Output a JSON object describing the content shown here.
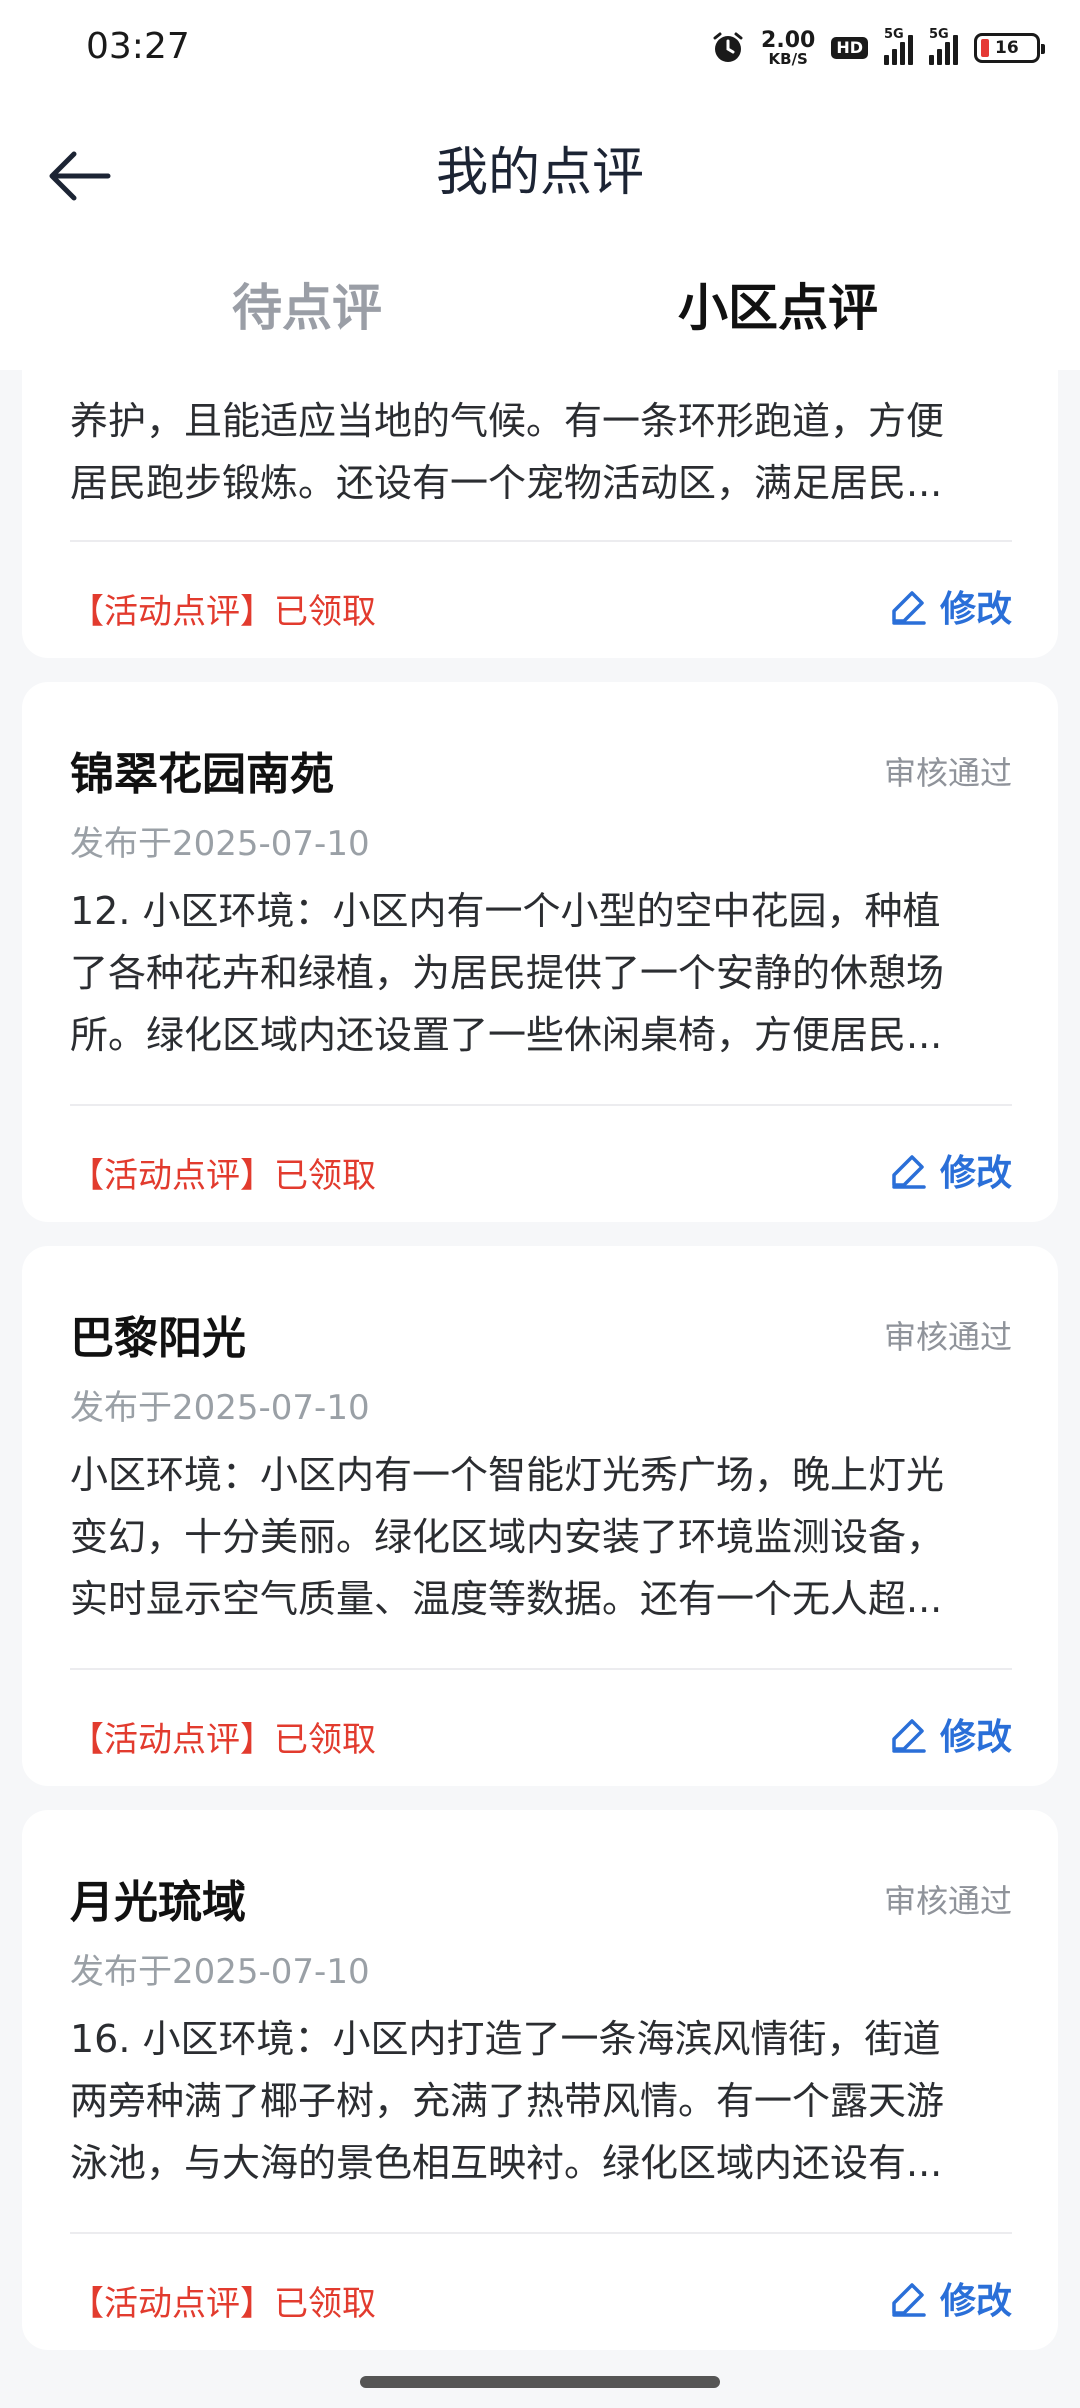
{
  "status_bar": {
    "time": "03:27",
    "net_speed_value": "2.00",
    "net_speed_unit": "KB/S",
    "hd_label": "HD",
    "signal_1_label": "5G",
    "signal_2_label": "5G",
    "battery_level": "16",
    "battery_color": "#e53935"
  },
  "header": {
    "title": "我的点评",
    "back_icon": "arrow-left-icon"
  },
  "tabs": [
    {
      "label": "待点评",
      "active": false
    },
    {
      "label": "小区点评",
      "active": true
    }
  ],
  "reviews": [
    {
      "title": "",
      "status": "",
      "date": "",
      "body_lines": [
        "养护，且能适应当地的气候。有一条环形跑道，方便",
        "居民跑步锻炼。还设有一个宠物活动区，满足居民..."
      ],
      "tag": "【活动点评】已领取",
      "edit_label": "修改"
    },
    {
      "title": "锦翠花园南苑",
      "status": "审核通过",
      "date": "发布于2025-07-10",
      "body_lines": [
        "12. 小区环境：小区内有一个小型的空中花园，种植",
        "了各种花卉和绿植，为居民提供了一个安静的休憩场",
        "所。绿化区域内还设置了一些休闲桌椅，方便居民..."
      ],
      "tag": "【活动点评】已领取",
      "edit_label": "修改"
    },
    {
      "title": "巴黎阳光",
      "status": "审核通过",
      "date": "发布于2025-07-10",
      "body_lines": [
        "小区环境：小区内有一个智能灯光秀广场，晚上灯光",
        "变幻，十分美丽。绿化区域内安装了环境监测设备，",
        "实时显示空气质量、温度等数据。还有一个无人超..."
      ],
      "tag": "【活动点评】已领取",
      "edit_label": "修改"
    },
    {
      "title": "月光琉域",
      "status": "审核通过",
      "date": "发布于2025-07-10",
      "body_lines": [
        "16. 小区环境：小区内打造了一条海滨风情街，街道",
        "两旁种满了椰子树，充满了热带风情。有一个露天游",
        "泳池，与大海的景色相互映衬。绿化区域内还设有..."
      ],
      "tag": "【活动点评】已领取",
      "edit_label": "修改"
    }
  ],
  "colors": {
    "accent_blue": "#2a6fd8",
    "tag_red": "#e23b2e",
    "status_gray": "#8f939a"
  }
}
